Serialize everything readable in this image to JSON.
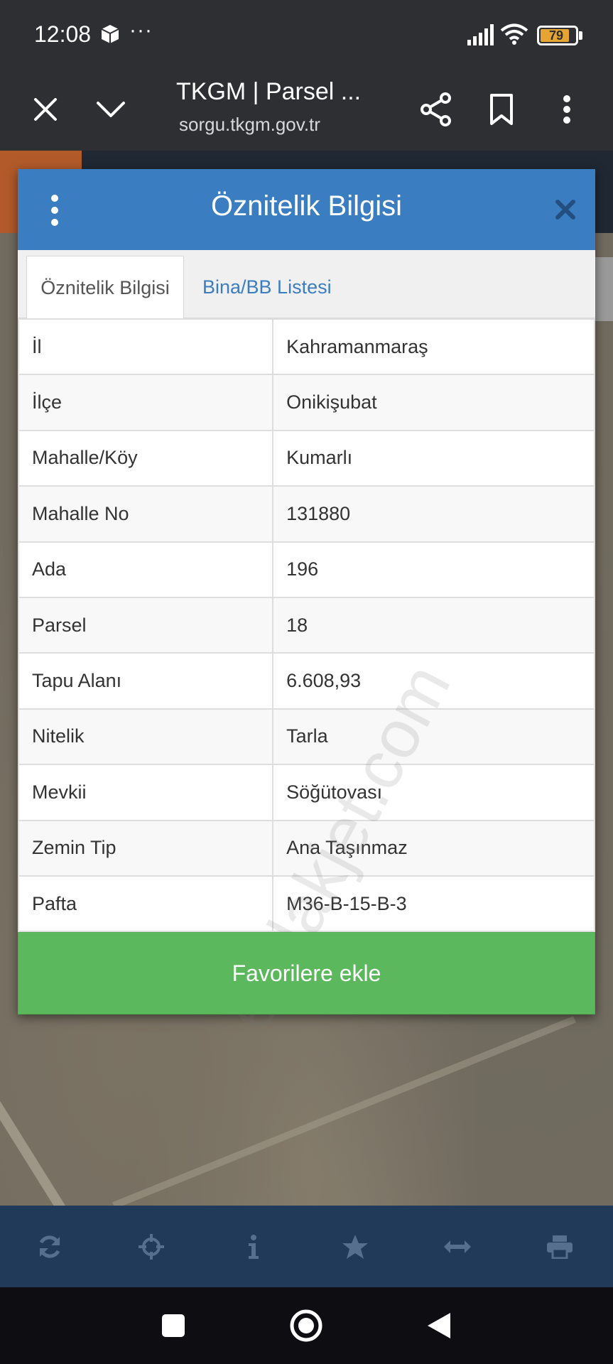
{
  "status_bar": {
    "time": "12:08",
    "more": "···",
    "battery": "79",
    "battery_color": "#e6a532"
  },
  "browser": {
    "title": "TKGM | Parsel ...",
    "url": "sorgu.tkgm.gov.tr",
    "icons": [
      "close-icon",
      "chevron-down-icon",
      "share-icon",
      "bookmark-icon",
      "more-vert-icon"
    ]
  },
  "dialog": {
    "title": "Öznitelik Bilgisi",
    "header_color": "#3a7dc0",
    "tabs": [
      {
        "label": "Öznitelik Bilgisi",
        "active": true
      },
      {
        "label": "Bina/BB Listesi",
        "active": false
      }
    ],
    "rows": [
      {
        "key": "İl",
        "value": "Kahramanmaraş"
      },
      {
        "key": "İlçe",
        "value": "Onikişubat"
      },
      {
        "key": "Mahalle/Köy",
        "value": "Kumarlı"
      },
      {
        "key": "Mahalle No",
        "value": "131880"
      },
      {
        "key": "Ada",
        "value": "196"
      },
      {
        "key": "Parsel",
        "value": "18"
      },
      {
        "key": "Tapu Alanı",
        "value": "6.608,93"
      },
      {
        "key": "Nitelik",
        "value": "Tarla"
      },
      {
        "key": "Mevkii",
        "value": "Söğütovası"
      },
      {
        "key": "Zemin Tip",
        "value": "Ana Taşınmaz"
      },
      {
        "key": "Pafta",
        "value": "M36-B-15-B-3"
      }
    ],
    "favorite_button": "Favorilere ekle",
    "favorite_color": "#5cb85c"
  },
  "watermark": "emlakjet.com",
  "bottom_tools": [
    "refresh-icon",
    "crosshair-icon",
    "info-icon",
    "star-icon",
    "measure-icon",
    "print-icon"
  ],
  "nav": [
    "recents-icon",
    "home-icon",
    "back-icon"
  ]
}
